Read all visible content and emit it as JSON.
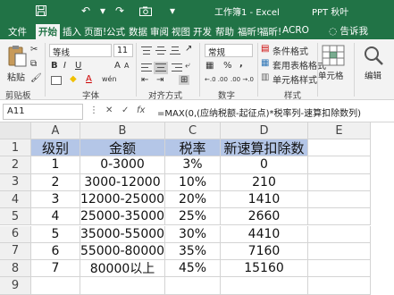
{
  "window": {
    "title": "工作簿1 - Excel",
    "account": "PPT 秋叶",
    "icons": [
      "save-icon",
      "undo-icon",
      "redo-icon",
      "camera-icon",
      "customize-icon"
    ]
  },
  "menu": {
    "tabs": [
      "文件",
      "开始",
      "插入",
      "页面!",
      "公式",
      "数据",
      "审阅",
      "视图",
      "开发",
      "帮助",
      "福昕!",
      "福昕!",
      "ACRO"
    ],
    "active_tab": "开始",
    "help_icon": "lightbulb-icon",
    "help_label": "告诉我"
  },
  "ribbon": {
    "clipboard": {
      "paste_label": "粘贴",
      "group_label": "剪贴板"
    },
    "font": {
      "font_name": "等线",
      "font_size": "11",
      "group_label": "字体",
      "wen_glyph": "wén",
      "bold": "B",
      "italic": "I",
      "underline": "U",
      "grow": "A",
      "shrink": "A",
      "font_color_glyph": "A"
    },
    "alignment": {
      "group_label": "对齐方式"
    },
    "number": {
      "format": "常规",
      "group_label": "数字",
      "percent": "%",
      "comma": ",",
      "decimal_inc": "←.0 .00",
      "decimal_dec": ".00 →.0"
    },
    "styles": {
      "conditional": "条件格式",
      "table_format": "套用表格格式",
      "cell_styles": "单元格样式",
      "group_label": "样式"
    },
    "cells": {
      "label": "单元格"
    },
    "editing": {
      "label": "编辑"
    }
  },
  "formula_bar": {
    "name_box": "A11",
    "cancel": "✕",
    "confirm": "✓",
    "fx": "fx",
    "formula": "=MAX(0,(应纳税额-起征点)*税率列-速算扣除数列)"
  },
  "sheet": {
    "columns": [
      "A",
      "B",
      "C",
      "D",
      "E"
    ],
    "rows": [
      "1",
      "2",
      "3",
      "4",
      "5",
      "6",
      "7",
      "8",
      "9"
    ],
    "header": [
      "级别",
      "金额",
      "税率",
      "新速算扣除数",
      ""
    ],
    "data": [
      [
        "1",
        "0-3000",
        "3%",
        "0",
        ""
      ],
      [
        "2",
        "3000-12000",
        "10%",
        "210",
        ""
      ],
      [
        "3",
        "12000-25000",
        "20%",
        "1410",
        ""
      ],
      [
        "4",
        "25000-35000",
        "25%",
        "2660",
        ""
      ],
      [
        "5",
        "35000-55000",
        "30%",
        "4410",
        ""
      ],
      [
        "6",
        "55000-80000",
        "35%",
        "7160",
        ""
      ],
      [
        "7",
        "80000以上",
        "45%",
        "15160",
        ""
      ],
      [
        "",
        "",
        "",
        "",
        ""
      ]
    ]
  }
}
